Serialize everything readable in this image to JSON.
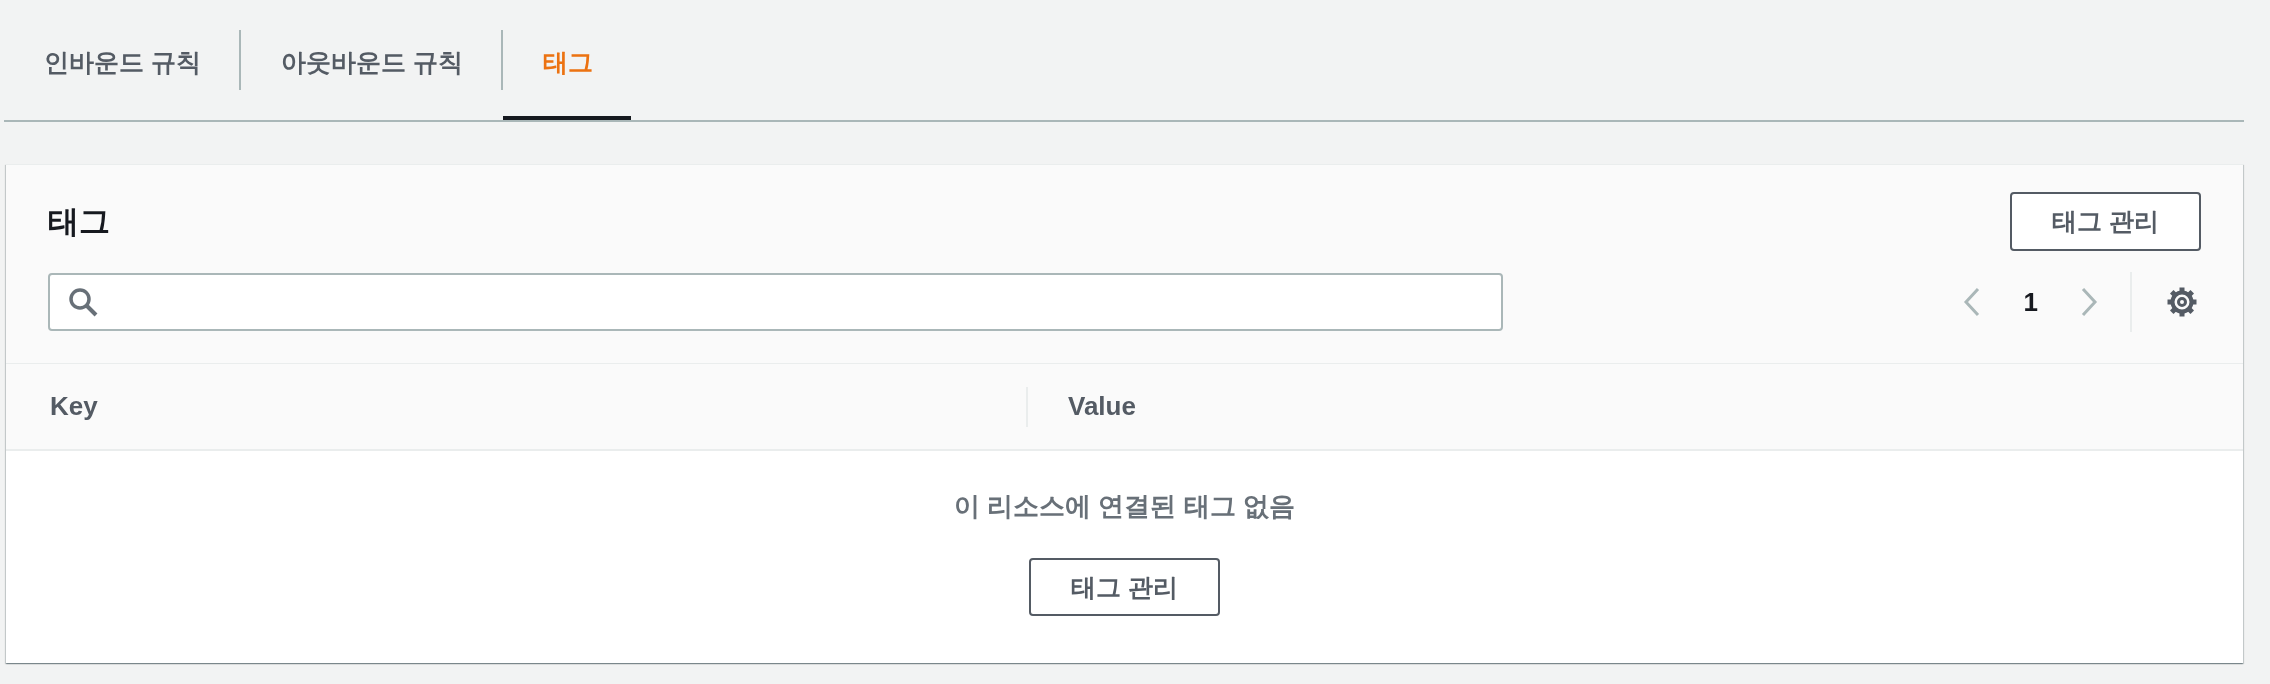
{
  "tabs": [
    {
      "label": "인바운드 규칙",
      "selected": false
    },
    {
      "label": "아웃바운드 규칙",
      "selected": false
    },
    {
      "label": "태그",
      "selected": true
    }
  ],
  "panel": {
    "title": "태그",
    "action_button": "태그 관리",
    "pagination": {
      "previous": {
        "disabled": true
      },
      "pages": [
        {
          "label": "1",
          "selected": true
        }
      ],
      "next": {
        "disabled": true
      }
    },
    "table": {
      "columns": [
        "Key",
        "Value"
      ],
      "empty_state": {
        "message": "이 리소스에 연결된 태그 없음",
        "button": "태그 관리"
      }
    }
  }
}
